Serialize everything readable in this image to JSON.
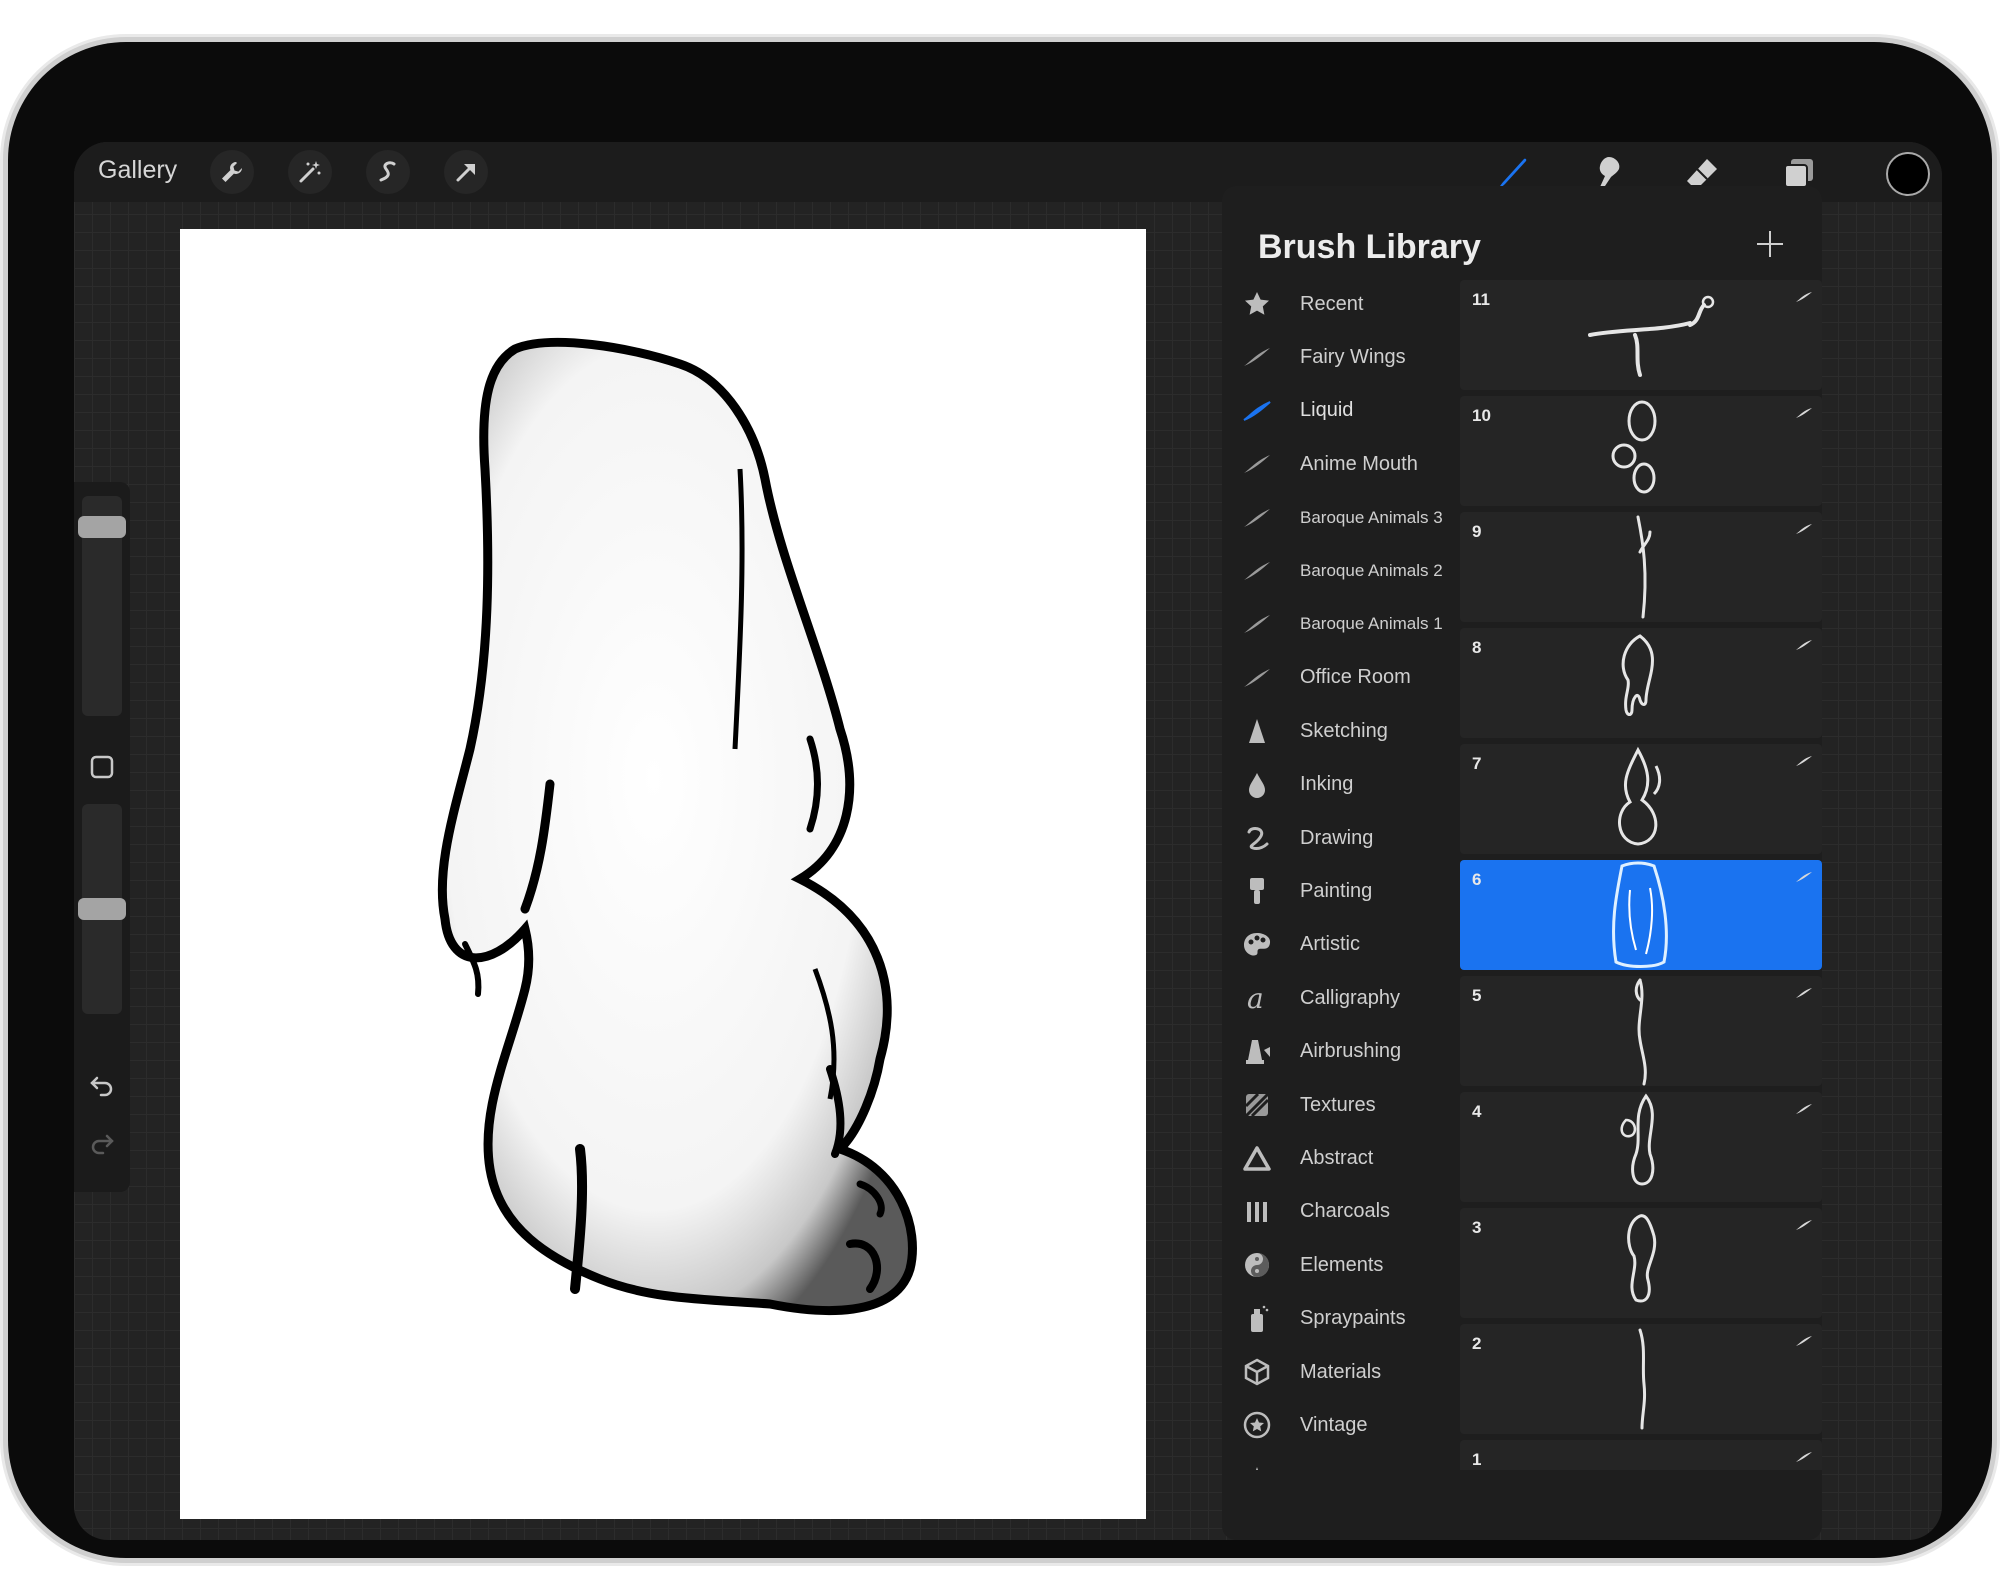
{
  "toolbar": {
    "gallery_label": "Gallery",
    "icons": [
      "wrench-icon",
      "magic-wand-icon",
      "selection-icon",
      "transform-arrow-icon",
      "brush-icon",
      "smudge-icon",
      "eraser-icon",
      "layers-icon",
      "color-icon"
    ],
    "active_tool": "brush",
    "accent_color": "#1a73f0",
    "current_color": "#000000"
  },
  "sidebar": {
    "brush_size_level": 0.9,
    "opacity_level": 0.5,
    "icons": [
      "modify-square-icon",
      "undo-icon",
      "redo-icon"
    ]
  },
  "panel": {
    "title": "Brush Library",
    "add_icon": "plus-icon",
    "categories": [
      {
        "label": "Recent",
        "icon": "star-icon",
        "active": false
      },
      {
        "label": "Fairy Wings",
        "icon": "stroke-icon",
        "active": false
      },
      {
        "label": "Liquid",
        "icon": "stroke-icon",
        "active": true
      },
      {
        "label": "Anime Mouth",
        "icon": "stroke-icon",
        "active": false
      },
      {
        "label": "Baroque Animals 3",
        "icon": "stroke-icon",
        "active": false
      },
      {
        "label": "Baroque Animals 2",
        "icon": "stroke-icon",
        "active": false
      },
      {
        "label": "Baroque Animals 1",
        "icon": "stroke-icon",
        "active": false
      },
      {
        "label": "Office Room",
        "icon": "stroke-icon",
        "active": false
      },
      {
        "label": "Sketching",
        "icon": "pencil-tip-icon",
        "active": false
      },
      {
        "label": "Inking",
        "icon": "ink-drop-icon",
        "active": false
      },
      {
        "label": "Drawing",
        "icon": "squiggle-icon",
        "active": false
      },
      {
        "label": "Painting",
        "icon": "paint-brush-icon",
        "active": false
      },
      {
        "label": "Artistic",
        "icon": "palette-icon",
        "active": false
      },
      {
        "label": "Calligraphy",
        "icon": "calligraphy-a-icon",
        "active": false
      },
      {
        "label": "Airbrushing",
        "icon": "airbrush-icon",
        "active": false
      },
      {
        "label": "Textures",
        "icon": "texture-icon",
        "active": false
      },
      {
        "label": "Abstract",
        "icon": "triangle-icon",
        "active": false
      },
      {
        "label": "Charcoals",
        "icon": "charcoal-bars-icon",
        "active": false
      },
      {
        "label": "Elements",
        "icon": "yin-yang-icon",
        "active": false
      },
      {
        "label": "Spraypaints",
        "icon": "spray-can-icon",
        "active": false
      },
      {
        "label": "Materials",
        "icon": "cube-icon",
        "active": false
      },
      {
        "label": "Vintage",
        "icon": "star-badge-icon",
        "active": false
      },
      {
        "label": "",
        "icon": "pencil-tip-icon",
        "active": false
      }
    ],
    "brushes": [
      {
        "number": "11",
        "selected": false
      },
      {
        "number": "10",
        "selected": false
      },
      {
        "number": "9",
        "selected": false
      },
      {
        "number": "8",
        "selected": false
      },
      {
        "number": "7",
        "selected": false
      },
      {
        "number": "6",
        "selected": true
      },
      {
        "number": "5",
        "selected": false
      },
      {
        "number": "4",
        "selected": false
      },
      {
        "number": "3",
        "selected": false
      },
      {
        "number": "2",
        "selected": false
      },
      {
        "number": "1",
        "selected": false
      }
    ]
  }
}
